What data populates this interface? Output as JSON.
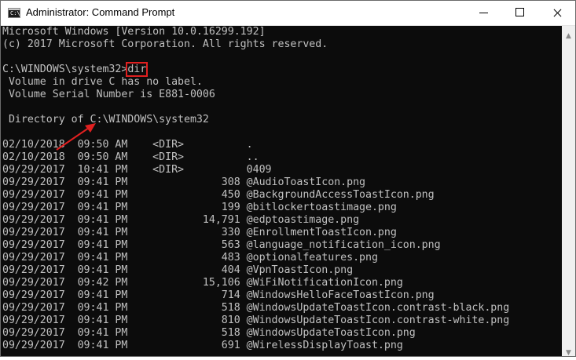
{
  "window": {
    "title": "Administrator: Command Prompt",
    "icon": "cmd-icon",
    "controls": [
      "minimize-icon",
      "maximize-icon",
      "close-icon"
    ]
  },
  "console": {
    "lines": [
      "Microsoft Windows [Version 10.0.16299.192]",
      "(c) 2017 Microsoft Corporation. All rights reserved.",
      "",
      "C:\\WINDOWS\\system32>dir",
      " Volume in drive C has no label.",
      " Volume Serial Number is E881-0006",
      "",
      " Directory of C:\\WINDOWS\\system32",
      "",
      "02/10/2018  09:50 AM    <DIR>          .",
      "02/10/2018  09:50 AM    <DIR>          ..",
      "09/29/2017  10:41 PM    <DIR>          0409",
      "09/29/2017  09:41 PM               308 @AudioToastIcon.png",
      "09/29/2017  09:41 PM               450 @BackgroundAccessToastIcon.png",
      "09/29/2017  09:41 PM               199 @bitlockertoastimage.png",
      "09/29/2017  09:41 PM            14,791 @edptoastimage.png",
      "09/29/2017  09:41 PM               330 @EnrollmentToastIcon.png",
      "09/29/2017  09:41 PM               563 @language_notification_icon.png",
      "09/29/2017  09:41 PM               483 @optionalfeatures.png",
      "09/29/2017  09:41 PM               404 @VpnToastIcon.png",
      "09/29/2017  09:42 PM            15,106 @WiFiNotificationIcon.png",
      "09/29/2017  09:41 PM               714 @WindowsHelloFaceToastIcon.png",
      "09/29/2017  09:41 PM               518 @WindowsUpdateToastIcon.contrast-black.png",
      "09/29/2017  09:41 PM               810 @WindowsUpdateToastIcon.contrast-white.png",
      "09/29/2017  09:41 PM               518 @WindowsUpdateToastIcon.png",
      "09/29/2017  09:41 PM               691 @WirelessDisplayToast.png"
    ],
    "prompt": "C:\\WINDOWS\\system32>",
    "command": "dir"
  },
  "colors": {
    "console_bg": "#0c0c0c",
    "console_text": "#c0c0c0",
    "annotation": "#e02020"
  }
}
